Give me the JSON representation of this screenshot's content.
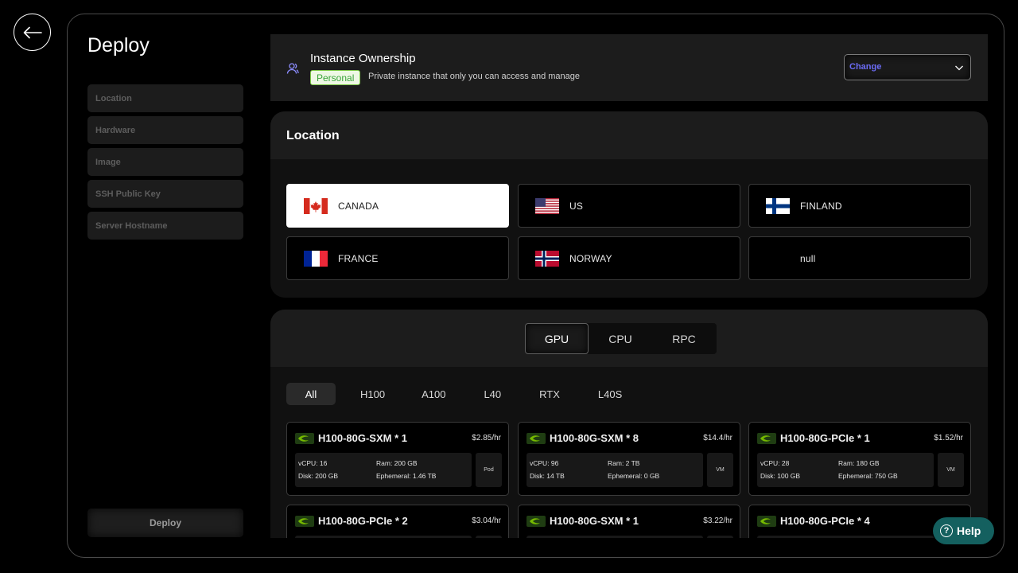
{
  "sidebar": {
    "title": "Deploy",
    "steps": [
      "Location",
      "Hardware",
      "Image",
      "SSH Public Key",
      "Server Hostname"
    ],
    "deploy_label": "Deploy"
  },
  "ownership": {
    "icon": "users-icon",
    "title": "Instance Ownership",
    "badge": "Personal",
    "description": "Private instance that only you can access and manage",
    "select_label": "Change"
  },
  "location": {
    "heading": "Location",
    "options": [
      "CANADA",
      "US",
      "FINLAND",
      "FRANCE",
      "NORWAY",
      "null"
    ],
    "selected": "CANADA"
  },
  "compute": {
    "tabs": [
      "GPU",
      "CPU",
      "RPC"
    ],
    "active_tab": "GPU",
    "filters": [
      "All",
      "H100",
      "A100",
      "L40",
      "RTX",
      "L40S"
    ],
    "active_filter": "All",
    "cards": [
      {
        "name": "H100-80G-SXM * 1",
        "price": "$2.85/hr",
        "vcpu": "vCPU: 16",
        "ram": "Ram: 200 GB",
        "disk": "Disk: 200 GB",
        "ephemeral": "Ephemeral: 1.46 TB",
        "type": "Pod"
      },
      {
        "name": "H100-80G-SXM * 8",
        "price": "$14.4/hr",
        "vcpu": "vCPU: 96",
        "ram": "Ram: 2 TB",
        "disk": "Disk: 14 TB",
        "ephemeral": "Ephemeral: 0 GB",
        "type": "VM"
      },
      {
        "name": "H100-80G-PCIe * 1",
        "price": "$1.52/hr",
        "vcpu": "vCPU: 28",
        "ram": "Ram: 180 GB",
        "disk": "Disk: 100 GB",
        "ephemeral": "Ephemeral: 750 GB",
        "type": "VM"
      },
      {
        "name": "H100-80G-PCIe * 2",
        "price": "$3.04/hr"
      },
      {
        "name": "H100-80G-SXM * 1",
        "price": "$3.22/hr"
      },
      {
        "name": "H100-80G-PCIe * 4"
      }
    ]
  },
  "help": {
    "label": "Help",
    "icon": "?"
  },
  "colors": {
    "accent": "#6b6bf5",
    "badge_green": "#3aa43a",
    "help_teal": "#14605f"
  }
}
